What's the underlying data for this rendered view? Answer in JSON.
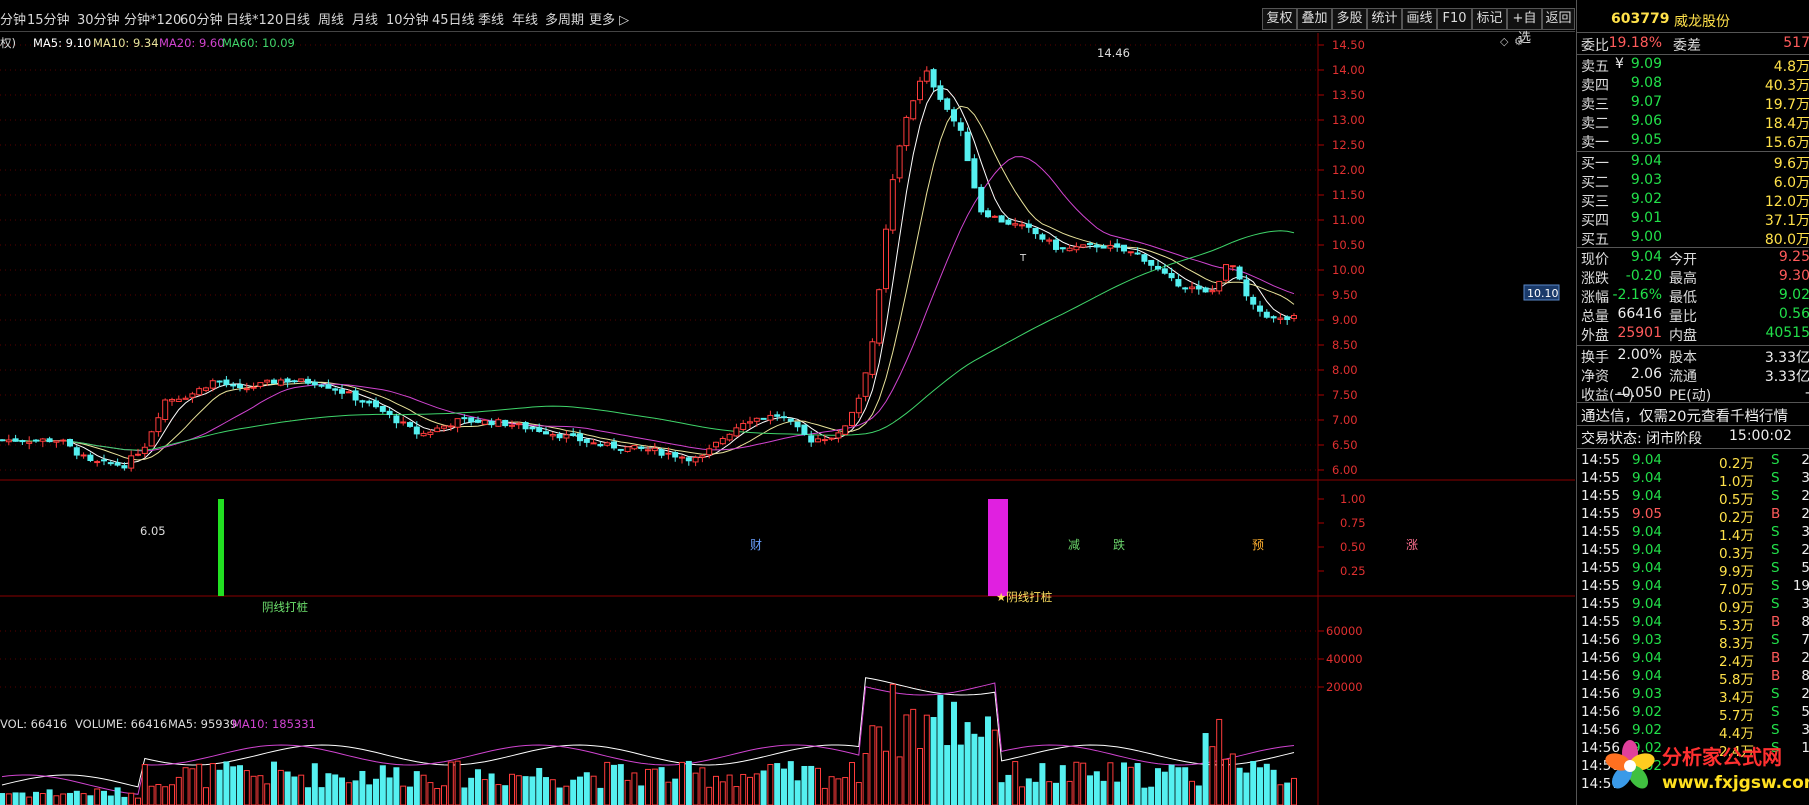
{
  "toolbar": {
    "periods": [
      "分钟",
      "15分钟",
      "30分钟",
      "分钟*120",
      "60分钟",
      "日线*120",
      "日线",
      "周线",
      "月线",
      "10分钟",
      "45日线",
      "季线",
      "年线",
      "多周期",
      "更多 ▷"
    ],
    "buttons": [
      "复权",
      "叠加",
      "多股",
      "统计",
      "画线",
      "F10",
      "标记",
      "+自选",
      "返回"
    ]
  },
  "legend": {
    "prefix": "权)",
    "ma5": "MA5: 9.10",
    "ma10": "MA10: 9.34",
    "ma20": "MA20: 9.60",
    "ma60": "MA60: 10.09"
  },
  "vol_legend": {
    "vol": "VOL: 66416",
    "volume": "VOLUME: 66416",
    "ma5": "MA5: 95939",
    "ma10": "MA10: 185331"
  },
  "indicator": {
    "label1": "阴线打桩",
    "label2": "★阴线打桩",
    "axis": [
      "1.00",
      "0.75",
      "0.50",
      "0.25"
    ]
  },
  "price_axis": [
    "14.50",
    "14.00",
    "13.50",
    "13.00",
    "12.50",
    "12.00",
    "11.50",
    "11.00",
    "10.50",
    "10.00",
    "9.50",
    "9.00",
    "8.50",
    "8.00",
    "7.50",
    "7.00",
    "6.50",
    "6.00"
  ],
  "vol_axis": [
    "60000",
    "40000",
    "20000"
  ],
  "current_price_tag": "10.10",
  "annotations": {
    "high": "14.46",
    "low": "6.05",
    "markers": [
      "财",
      "减",
      "跌",
      "预",
      "涨"
    ],
    "t_mark": "T"
  },
  "stock": {
    "code": "603779",
    "name": "威龙股份",
    "weibi_label": "委比",
    "weibi_value": "19.18%",
    "weicha_label": "委差",
    "weicha_value": "517"
  },
  "order_book": {
    "sell": [
      {
        "label": "卖五",
        "price": "9.09",
        "vol": "4.8万"
      },
      {
        "label": "卖四",
        "price": "9.08",
        "vol": "40.3万"
      },
      {
        "label": "卖三",
        "price": "9.07",
        "vol": "19.7万"
      },
      {
        "label": "卖二",
        "price": "9.06",
        "vol": "18.4万"
      },
      {
        "label": "卖一",
        "price": "9.05",
        "vol": "15.6万"
      }
    ],
    "buy": [
      {
        "label": "买一",
        "price": "9.04",
        "vol": "9.6万"
      },
      {
        "label": "买二",
        "price": "9.03",
        "vol": "6.0万"
      },
      {
        "label": "买三",
        "price": "9.02",
        "vol": "12.0万"
      },
      {
        "label": "买四",
        "price": "9.01",
        "vol": "37.1万"
      },
      {
        "label": "买五",
        "price": "9.00",
        "vol": "80.0万"
      }
    ],
    "yen_sign": "¥"
  },
  "quote": [
    {
      "l1": "现价",
      "v1": "9.04",
      "c1": "green",
      "l2": "今开",
      "v2": "9.25",
      "c2": "red"
    },
    {
      "l1": "涨跌",
      "v1": "-0.20",
      "c1": "green",
      "l2": "最高",
      "v2": "9.30",
      "c2": "red"
    },
    {
      "l1": "涨幅",
      "v1": "-2.16%",
      "c1": "green",
      "l2": "最低",
      "v2": "9.02",
      "c2": "green"
    },
    {
      "l1": "总量",
      "v1": "66416",
      "c1": "white",
      "l2": "量比",
      "v2": "0.56",
      "c2": "green"
    },
    {
      "l1": "外盘",
      "v1": "25901",
      "c1": "red",
      "l2": "内盘",
      "v2": "40515",
      "c2": "green"
    },
    {
      "l1": "换手",
      "v1": "2.00%",
      "c1": "white",
      "l2": "股本",
      "v2": "3.33亿",
      "c2": "white"
    },
    {
      "l1": "净资",
      "v1": "2.06",
      "c1": "white",
      "l2": "流通",
      "v2": "3.33亿",
      "c2": "white"
    },
    {
      "l1": "收益(一)",
      "v1": "-0.050",
      "c1": "white",
      "l2": "PE(动)",
      "v2": "-",
      "c2": "white"
    }
  ],
  "ad_text": "通达信，仅需20元查看千档行情",
  "status": {
    "label": "交易状态: 闭市阶段",
    "time": "15:00:02"
  },
  "ticks": [
    {
      "t": "14:55",
      "p": "9.04",
      "v": "0.2万",
      "s": "S",
      "n": "2"
    },
    {
      "t": "14:55",
      "p": "9.04",
      "v": "1.0万",
      "s": "S",
      "n": "3"
    },
    {
      "t": "14:55",
      "p": "9.04",
      "v": "0.5万",
      "s": "S",
      "n": "2"
    },
    {
      "t": "14:55",
      "p": "9.05",
      "v": "0.2万",
      "s": "B",
      "n": "2"
    },
    {
      "t": "14:55",
      "p": "9.04",
      "v": "1.4万",
      "s": "S",
      "n": "3"
    },
    {
      "t": "14:55",
      "p": "9.04",
      "v": "0.3万",
      "s": "S",
      "n": "2"
    },
    {
      "t": "14:55",
      "p": "9.04",
      "v": "9.9万",
      "s": "S",
      "n": "5"
    },
    {
      "t": "14:55",
      "p": "9.04",
      "v": "7.0万",
      "s": "S",
      "n": "19"
    },
    {
      "t": "14:55",
      "p": "9.04",
      "v": "0.9万",
      "s": "S",
      "n": "3"
    },
    {
      "t": "14:55",
      "p": "9.04",
      "v": "5.3万",
      "s": "B",
      "n": "8"
    },
    {
      "t": "14:56",
      "p": "9.03",
      "v": "8.3万",
      "s": "S",
      "n": "7"
    },
    {
      "t": "14:56",
      "p": "9.04",
      "v": "2.4万",
      "s": "B",
      "n": "2"
    },
    {
      "t": "14:56",
      "p": "9.04",
      "v": "5.8万",
      "s": "B",
      "n": "8"
    },
    {
      "t": "14:56",
      "p": "9.03",
      "v": "3.4万",
      "s": "S",
      "n": "2"
    },
    {
      "t": "14:56",
      "p": "9.02",
      "v": "5.7万",
      "s": "S",
      "n": "5"
    },
    {
      "t": "14:56",
      "p": "9.02",
      "v": "4.4万",
      "s": "S",
      "n": "3"
    },
    {
      "t": "14:56",
      "p": "9.02",
      "v": "2.4万",
      "s": "S",
      "n": "1"
    },
    {
      "t": "14:56",
      "p": "9.02",
      "v": "",
      "s": "",
      "n": ""
    },
    {
      "t": "14:57",
      "p": "",
      "v": "",
      "s": "",
      "n": ""
    }
  ],
  "logo": {
    "line1": "分析家公式网",
    "line2": "www.fxjgsw.com"
  },
  "colors": {
    "up": "#ff3c3c",
    "down": "#55f0f0",
    "ma5": "#ffffff",
    "ma10": "#e8e29a",
    "ma20": "#d044d0",
    "ma60": "#3fd46a"
  }
}
